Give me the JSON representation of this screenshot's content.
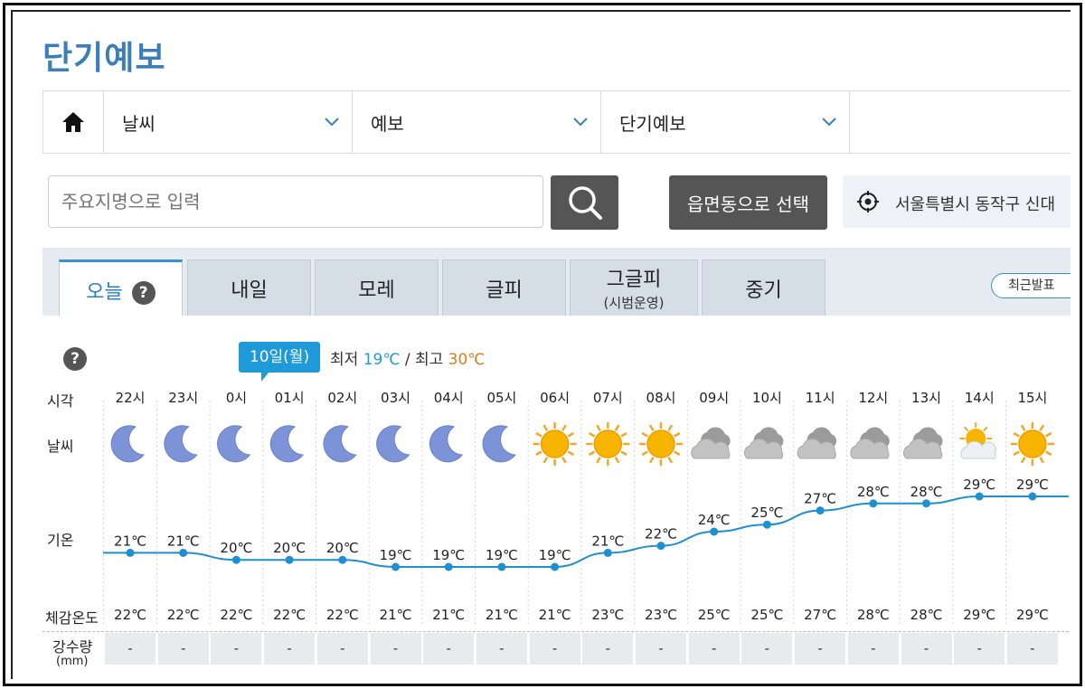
{
  "page_title": "단기예보",
  "nav": [
    {
      "label": "날씨"
    },
    {
      "label": "예보"
    },
    {
      "label": "단기예보"
    }
  ],
  "search": {
    "placeholder": "주요지명으로 입력"
  },
  "eup_button": "읍면동으로 선택",
  "location": "서울특별시 동작구 신대",
  "tabs": [
    {
      "label": "오늘",
      "help": "?"
    },
    {
      "label": "내일"
    },
    {
      "label": "모레"
    },
    {
      "label": "글피"
    },
    {
      "label": "그글피",
      "sub": "(시범운영)"
    },
    {
      "label": "중기"
    }
  ],
  "recent_button": "최근발표",
  "date_badge": "10일(월)",
  "min_label": "최저",
  "min_value": "19℃",
  "max_label": "최고",
  "max_value": "30℃",
  "separator": "/",
  "help_mark": "?",
  "row_labels": {
    "time": "시각",
    "weather": "날씨",
    "temp": "기온",
    "feels": "체감온도",
    "precip": "강수량",
    "precip_unit": "(mm)"
  },
  "chart_data": {
    "type": "line",
    "hours": [
      "22시",
      "23시",
      "0시",
      "01시",
      "02시",
      "03시",
      "04시",
      "05시",
      "06시",
      "07시",
      "08시",
      "09시",
      "10시",
      "11시",
      "12시",
      "13시",
      "14시",
      "15시"
    ],
    "weather_icons": [
      "moon-icon",
      "moon-icon",
      "moon-icon",
      "moon-icon",
      "moon-icon",
      "moon-icon",
      "moon-icon",
      "moon-icon",
      "sun-icon",
      "sun-icon",
      "sun-icon",
      "cloudy-icon",
      "cloudy-icon",
      "cloudy-icon",
      "cloudy-icon",
      "cloudy-icon",
      "partly-cloudy-icon",
      "sun-icon"
    ],
    "temperature": [
      21,
      21,
      20,
      20,
      20,
      19,
      19,
      19,
      19,
      21,
      22,
      24,
      25,
      27,
      28,
      28,
      29,
      29
    ],
    "temperature_labels": [
      "21℃",
      "21℃",
      "20℃",
      "20℃",
      "20℃",
      "19℃",
      "19℃",
      "19℃",
      "19℃",
      "21℃",
      "22℃",
      "24℃",
      "25℃",
      "27℃",
      "28℃",
      "28℃",
      "29℃",
      "29℃"
    ],
    "feels_like": [
      "22℃",
      "22℃",
      "22℃",
      "22℃",
      "22℃",
      "21℃",
      "21℃",
      "21℃",
      "21℃",
      "23℃",
      "23℃",
      "25℃",
      "25℃",
      "27℃",
      "28℃",
      "28℃",
      "29℃",
      "29℃"
    ],
    "precipitation": [
      "-",
      "-",
      "-",
      "-",
      "-",
      "-",
      "-",
      "-",
      "-",
      "-",
      "-",
      "-",
      "-",
      "-",
      "-",
      "-",
      "-",
      "-"
    ],
    "ylim": [
      19,
      29
    ],
    "line_color": "#1e8fd0"
  }
}
